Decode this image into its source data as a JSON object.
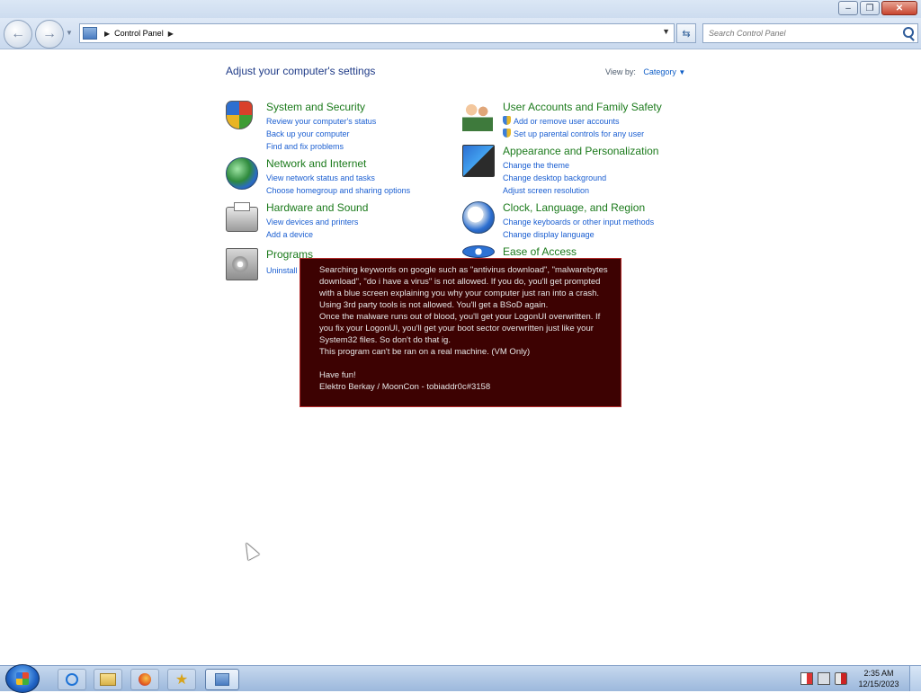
{
  "window": {
    "controls": [
      "minimize",
      "maximize",
      "close"
    ]
  },
  "toolbar": {
    "breadcrumb": [
      "Control Panel"
    ],
    "search_placeholder": "Search Control Panel"
  },
  "content": {
    "heading": "Adjust your computer's settings",
    "view_by_label": "View by:",
    "view_by_value": "Category",
    "categories": [
      {
        "title": "System and Security",
        "links": [
          "Review your computer's status",
          "Back up your computer",
          "Find and fix problems"
        ]
      },
      {
        "title": "Network and Internet",
        "links": [
          "View network status and tasks",
          "Choose homegroup and sharing options"
        ]
      },
      {
        "title": "Hardware and Sound",
        "links": [
          "View devices and printers",
          "Add a device"
        ]
      },
      {
        "title": "Programs",
        "links": [
          "Uninstall"
        ]
      },
      {
        "title": "User Accounts and Family Safety",
        "links": [
          "Add or remove user accounts",
          "Set up parental controls for any user"
        ]
      },
      {
        "title": "Appearance and Personalization",
        "links": [
          "Change the theme",
          "Change desktop background",
          "Adjust screen resolution"
        ]
      },
      {
        "title": "Clock, Language, and Region",
        "links": [
          "Change keyboards or other input methods",
          "Change display language"
        ]
      },
      {
        "title": "Ease of Access",
        "links": []
      }
    ]
  },
  "message": {
    "lines": [
      "Searching keywords on google such as \"antivirus download\", \"malwarebytes download\", \"do i have a virus\" is not allowed. If you do, you'll get prompted with a blue screen explaining you why your computer just ran into a crash.",
      "Using 3rd party tools is not allowed. You'll get a BSoD again.",
      "Once the malware runs out of blood, you'll get your LogonUI overwritten. If you fix your LogonUI, you'll get your boot sector overwritten just like your System32 files. So don't do that ig.",
      "This program can't be ran on a real machine. (VM Only)",
      "Have fun!",
      "Elektro Berkay / MoonCon - tobiaddr0c#3158"
    ]
  },
  "taskbar": {
    "time": "2:35 AM",
    "date": "12/15/2023",
    "pinned": [
      "internet-explorer",
      "windows-explorer",
      "firefox",
      "star-app"
    ],
    "active": "control-panel"
  },
  "colors": {
    "heading": "#1e3a87",
    "category_title": "#1b7a1b",
    "link": "#1a5ed1",
    "message_bg": "#3d0202",
    "message_border": "#b42a2a"
  }
}
